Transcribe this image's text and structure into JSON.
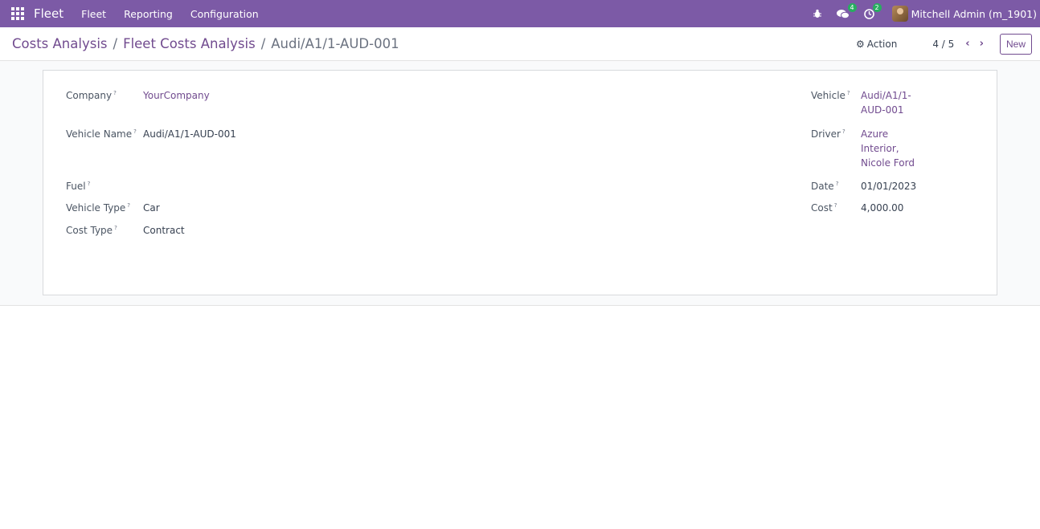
{
  "navbar": {
    "brand": "Fleet",
    "menu": [
      "Fleet",
      "Reporting",
      "Configuration"
    ],
    "messages_count": "4",
    "activities_count": "2",
    "user": "Mitchell Admin (m_1901)"
  },
  "breadcrumb": {
    "items": [
      "Costs Analysis",
      "Fleet Costs Analysis"
    ],
    "current": "Audi/A1/1-AUD-001",
    "separator": "/"
  },
  "control": {
    "action_label": "Action",
    "pager": "4 / 5",
    "new_label": "New"
  },
  "form": {
    "left": {
      "company": {
        "label": "Company",
        "value": "YourCompany"
      },
      "vehicle_name": {
        "label": "Vehicle Name",
        "value": "Audi/A1/1-AUD-001"
      },
      "fuel": {
        "label": "Fuel",
        "value": ""
      },
      "vehicle_type": {
        "label": "Vehicle Type",
        "value": "Car"
      },
      "cost_type": {
        "label": "Cost Type",
        "value": "Contract"
      }
    },
    "right": {
      "vehicle": {
        "label": "Vehicle",
        "value_line1": "Audi/A1/1-",
        "value_line2": "AUD-001"
      },
      "driver": {
        "label": "Driver",
        "value_line1": "Azure",
        "value_line2": "Interior,",
        "value_line3": "Nicole Ford"
      },
      "date": {
        "label": "Date",
        "value": "01/01/2023"
      },
      "cost": {
        "label": "Cost",
        "value": "4,000.00"
      }
    },
    "help_marker": "?"
  },
  "colors": {
    "navbar": "#7c5aa6",
    "link": "#714b8f",
    "badge": "#27ae60"
  }
}
